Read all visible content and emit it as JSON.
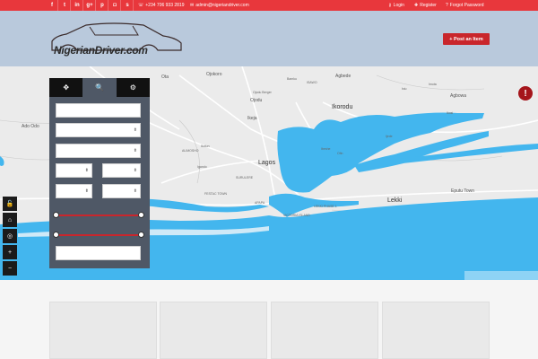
{
  "topbar": {
    "social": [
      {
        "icon": "facebook-icon",
        "glyph": "f"
      },
      {
        "icon": "twitter-icon",
        "glyph": "t"
      },
      {
        "icon": "linkedin-icon",
        "glyph": "in"
      },
      {
        "icon": "google-plus-icon",
        "glyph": "g+"
      },
      {
        "icon": "pinterest-icon",
        "glyph": "p"
      },
      {
        "icon": "instagram-icon",
        "glyph": "◘"
      },
      {
        "icon": "skype-icon",
        "glyph": "s"
      }
    ],
    "phone": "+234 706 933 2819",
    "email": "admin@nigeriandriver.com",
    "login": "Login",
    "register": "Register",
    "forgot": "Forgot Password"
  },
  "header": {
    "logo_text": "NigerianDriver.com",
    "post_button": "+ Post an Item"
  },
  "map": {
    "labels": {
      "ota": "Ota",
      "ojokoro": "Ojokoro",
      "ojodu_berger": "Ojodu Berger",
      "ojodu": "Ojodu",
      "ikeja": "Ikeja",
      "isawo": "ISAWO",
      "agbede": "Agbede",
      "ikorodu": "Ikorodu",
      "isiu": "Isiu",
      "imota": "Imota",
      "agbowa": "Agbowa",
      "ikosi": "Ikosi",
      "ado_odo": "Ado Odo",
      "alimosho": "ALIMOSHO",
      "ikotun": "Ikotun",
      "igando": "Igando",
      "lagos": "Lagos",
      "surulere": "SURULERE",
      "festac": "FESTAC TOWN",
      "badagry": "Badagry",
      "ibeshe": "Ibeshe",
      "ofin": "Ofin",
      "ijede": "Ijede",
      "lekki": "Lekki",
      "lekki_phase": "LEKKI PHASE 1",
      "victoria_island": "VICTORIA ISLAND",
      "eputu": "Eputu Town",
      "apapa": "APAPA",
      "bamku": "Bamku"
    },
    "alert_glyph": "!",
    "controls": [
      {
        "icon": "lock-icon",
        "glyph": "🔓"
      },
      {
        "icon": "home-icon",
        "glyph": "⌂"
      },
      {
        "icon": "locate-icon",
        "glyph": "◎"
      },
      {
        "icon": "zoom-in-icon",
        "glyph": "+"
      },
      {
        "icon": "zoom-out-icon",
        "glyph": "−"
      }
    ]
  },
  "search_panel": {
    "tabs": [
      {
        "icon": "move-icon",
        "glyph": "✥"
      },
      {
        "icon": "search-icon",
        "glyph": "🔍"
      },
      {
        "icon": "settings-icon",
        "glyph": "⚙"
      }
    ],
    "keyword_placeholder": "",
    "caret_glyph": "⬍",
    "range1": {
      "min": 0,
      "max": 1
    },
    "range2": {
      "min": 0,
      "max": 1
    }
  },
  "colors": {
    "topbar": "#e8373c",
    "header": "#b9c9dc",
    "water": "#43b6ee",
    "accent": "#c9262c"
  }
}
